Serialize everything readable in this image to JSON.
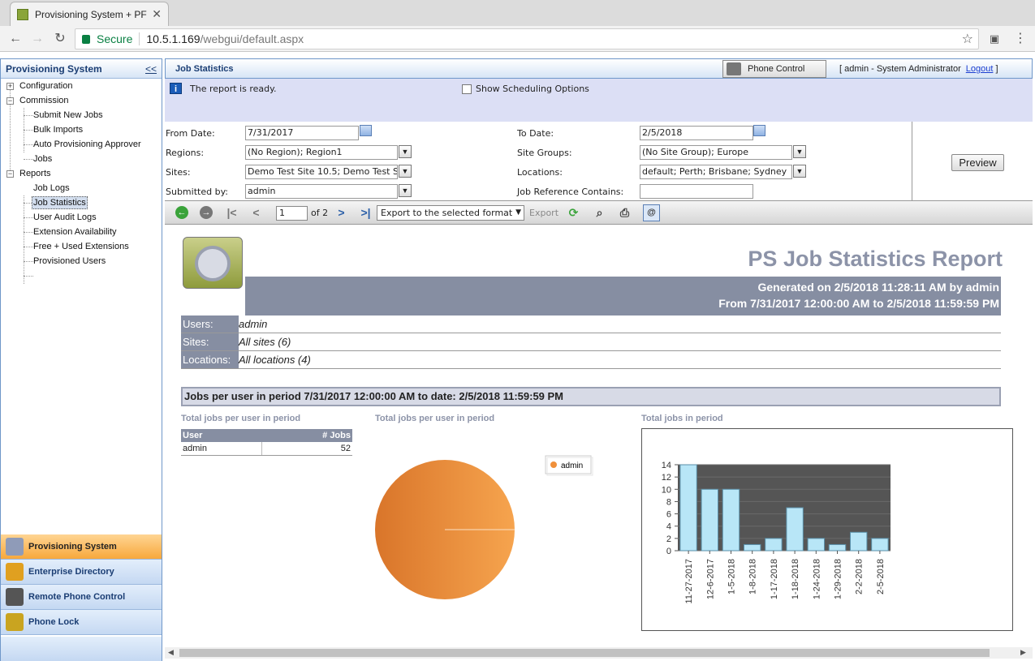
{
  "browser": {
    "tab_title": "Provisioning System + PF",
    "secure_label": "Secure",
    "url_host": "10.5.1.169",
    "url_path": "/webgui/default.aspx"
  },
  "left_panel": {
    "title": "Provisioning System",
    "collapse_label": "<<",
    "tree": {
      "configuration": "Configuration",
      "commission": "Commission",
      "submit_new_jobs": "Submit New Jobs",
      "bulk_imports": "Bulk Imports",
      "auto_provisioning_approver": "Auto Provisioning Approver",
      "jobs": "Jobs",
      "reports": "Reports",
      "job_logs": "Job Logs",
      "job_statistics": "Job Statistics",
      "user_audit_logs": "User Audit Logs",
      "extension_availability": "Extension Availability",
      "free_used_extensions": "Free + Used Extensions",
      "provisioned_users": "Provisioned Users"
    },
    "modules": {
      "provisioning_system": "Provisioning System",
      "enterprise_directory": "Enterprise Directory",
      "remote_phone_control": "Remote Phone Control",
      "phone_lock": "Phone Lock"
    }
  },
  "header": {
    "title": "Job Statistics",
    "phone_control": "Phone Control",
    "user_bracket_open": "[ admin - System Administrator",
    "logout": "Logout",
    "user_bracket_close": "]"
  },
  "info": {
    "message": "The report is ready.",
    "show_scheduling": "Show Scheduling Options"
  },
  "params": {
    "from_date_label": "From Date:",
    "from_date": "7/31/2017",
    "to_date_label": "To Date:",
    "to_date": "2/5/2018",
    "regions_label": "Regions:",
    "regions": "(No Region); Region1",
    "site_groups_label": "Site Groups:",
    "site_groups": "(No Site Group); Europe",
    "sites_label": "Sites:",
    "sites": "Demo Test Site 10.5; Demo Test Si",
    "locations_label": "Locations:",
    "locations": "default; Perth; Brisbane; Sydney",
    "submitted_by_label": "Submitted by:",
    "submitted_by": "admin",
    "job_ref_label": "Job Reference Contains:",
    "job_ref": "",
    "preview": "Preview"
  },
  "toolbar": {
    "page": "1",
    "of_pages": "of 2",
    "export_format": "Export to the selected format",
    "export": "Export"
  },
  "report": {
    "title": "PS Job Statistics Report",
    "generated": "Generated on 2/5/2018 11:28:11 AM by admin",
    "range": "From 7/31/2017 12:00:00 AM to 2/5/2018 11:59:59 PM",
    "users_label": "Users:",
    "users_value": "admin",
    "sites_label": "Sites:",
    "sites_value": "All sites (6)",
    "locations_label": "Locations:",
    "locations_value": "All locations (4)",
    "section_title": "Jobs per user in period  7/31/2017 12:00:00 AM to date: 2/5/2018 11:59:59 PM",
    "table_title": "Total jobs per user in period",
    "table_headers": [
      "User",
      "# Jobs"
    ],
    "table_rows": [
      [
        "admin",
        "52"
      ]
    ],
    "pie_title": "Total jobs per user in period",
    "bar_title": "Total jobs in period"
  },
  "chart_data": [
    {
      "type": "pie",
      "title": "Total jobs per user in period",
      "categories": [
        "admin"
      ],
      "values": [
        52
      ],
      "legend": "top-right",
      "colors": [
        "#f0903a"
      ]
    },
    {
      "type": "bar",
      "title": "Total jobs in period",
      "categories": [
        "11-27-2017",
        "12-6-2017",
        "1-5-2018",
        "1-8-2018",
        "1-17-2018",
        "1-18-2018",
        "1-24-2018",
        "1-29-2018",
        "2-2-2018",
        "2-5-2018"
      ],
      "values": [
        14,
        10,
        10,
        1,
        2,
        7,
        2,
        1,
        3,
        2
      ],
      "yticks": [
        0,
        2,
        4,
        6,
        8,
        10,
        12,
        14
      ],
      "ylim": [
        0,
        14
      ],
      "colors": [
        "#b8e6f7"
      ]
    }
  ]
}
